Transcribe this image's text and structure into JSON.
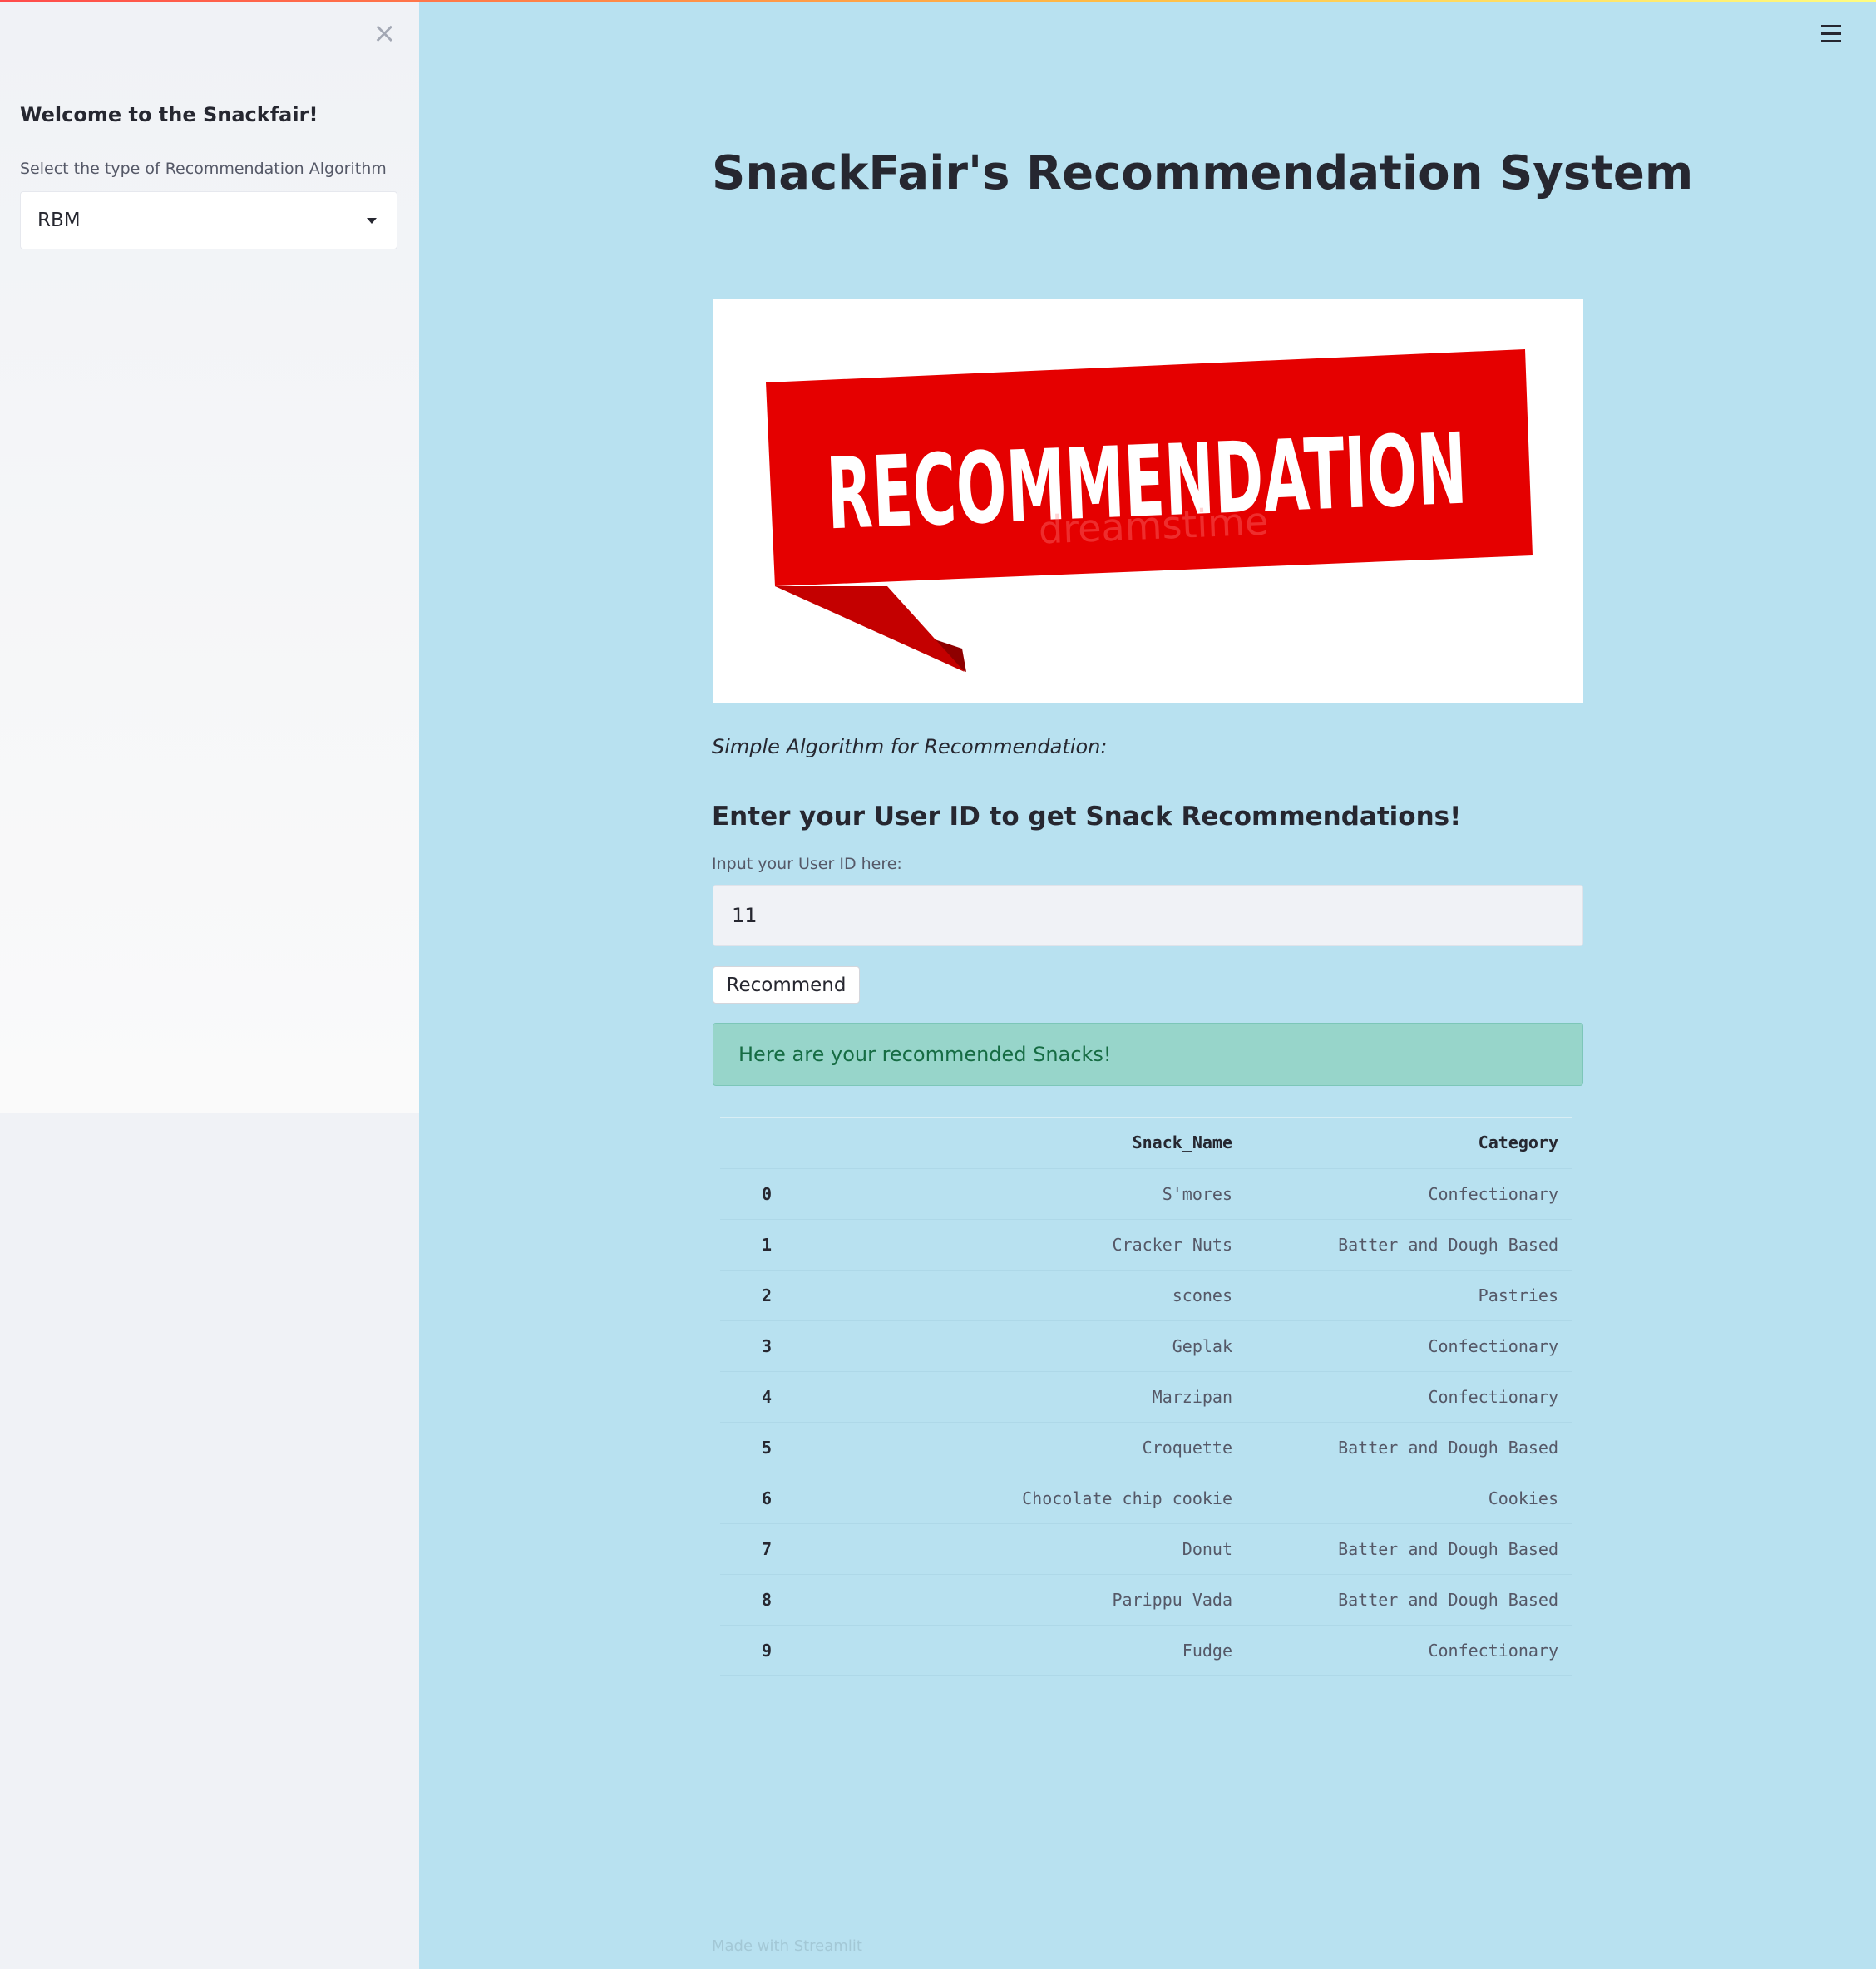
{
  "sidebar": {
    "close_icon": "×",
    "title": "Welcome to the Snackfair!",
    "select_label": "Select the type of Recommendation Algorithm",
    "selected_algorithm": "RBM"
  },
  "main": {
    "title": "SnackFair's Recommendation System",
    "banner_text": "RECOMMENDATION",
    "banner_watermark": "dreamstime",
    "caption": "Simple Algorithm for Recommendation:",
    "subheading": "Enter your User ID to get Snack Recommendations!",
    "input_label": "Input your User ID here:",
    "input_value": "11",
    "button_label": "Recommend",
    "success_message": "Here are your recommended Snacks!"
  },
  "table": {
    "headers": [
      "",
      "Snack_Name",
      "Category"
    ],
    "rows": [
      [
        "0",
        "S'mores",
        "Confectionary"
      ],
      [
        "1",
        "Cracker Nuts",
        "Batter and Dough Based"
      ],
      [
        "2",
        "scones",
        "Pastries"
      ],
      [
        "3",
        "Geplak",
        "Confectionary"
      ],
      [
        "4",
        "Marzipan",
        "Confectionary"
      ],
      [
        "5",
        "Croquette",
        "Batter and Dough Based"
      ],
      [
        "6",
        "Chocolate chip cookie",
        "Cookies"
      ],
      [
        "7",
        "Donut",
        "Batter and Dough Based"
      ],
      [
        "8",
        "Parippu Vada",
        "Batter and Dough Based"
      ],
      [
        "9",
        "Fudge",
        "Confectionary"
      ]
    ]
  },
  "footer": "Made with Streamlit",
  "colors": {
    "main_bg": "#b8e1f0",
    "sidebar_bg": "#f0f2f6",
    "banner_red": "#e00000",
    "success_bg": "#97d5ca",
    "success_text": "#166c43"
  }
}
